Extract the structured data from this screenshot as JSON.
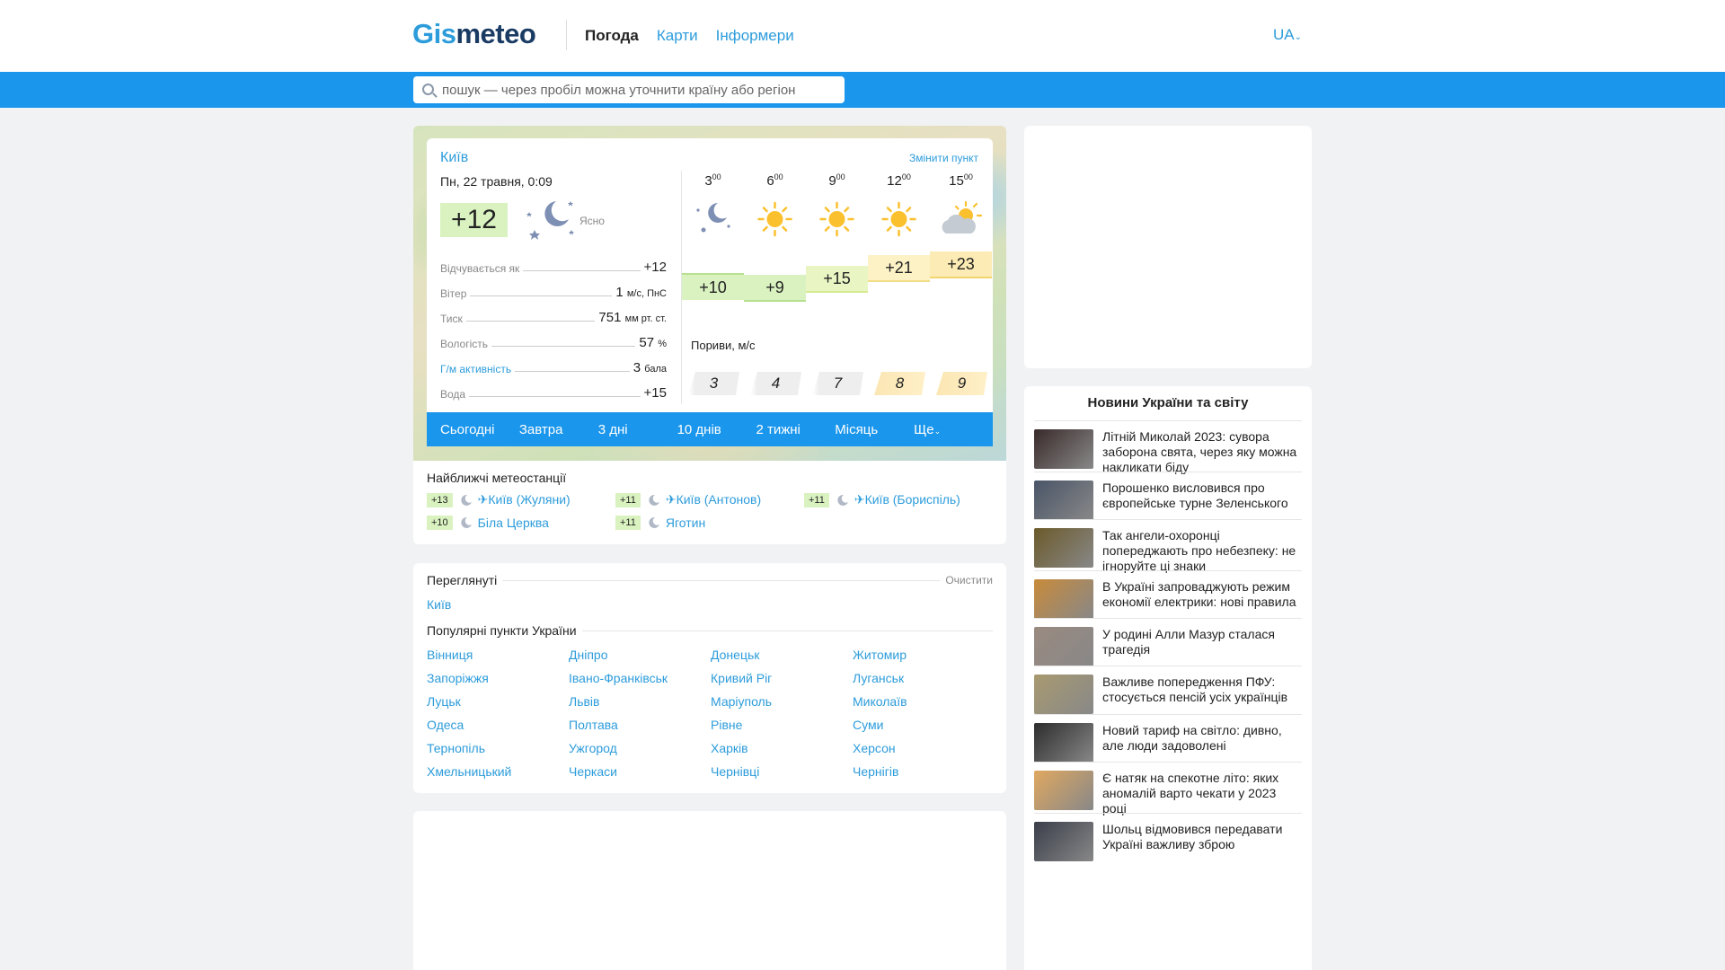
{
  "header": {
    "logo_part1": "Gis",
    "logo_part2": "meteo",
    "nav": [
      "Погода",
      "Карти",
      "Інформери"
    ],
    "lang": "UA"
  },
  "search": {
    "placeholder": "пошук — через пробіл можна уточнити країну або регіон"
  },
  "weather": {
    "city": "Київ",
    "change_label": "Змінити пункт",
    "date": "Пн, 22 травня, 0:09",
    "current_temp": "+12",
    "condition": "Ясно",
    "params": [
      {
        "label": "Відчувається як",
        "value": "+12",
        "unit": ""
      },
      {
        "label": "Вітер",
        "value": "1",
        "unit": "м/с, ПнС"
      },
      {
        "label": "Тиск",
        "value": "751",
        "unit": "мм рт. ст."
      },
      {
        "label": "Вологість",
        "value": "57",
        "unit": "%"
      },
      {
        "label": "Г/м активність",
        "value": "3",
        "unit": "бала"
      },
      {
        "label": "Вода",
        "value": "+15",
        "unit": ""
      }
    ],
    "hours": [
      {
        "hour": "3",
        "min": "00",
        "temp": "+10",
        "icon": "moon-stars-icon",
        "gust": "3"
      },
      {
        "hour": "6",
        "min": "00",
        "temp": "+9",
        "icon": "sun-icon",
        "gust": "4"
      },
      {
        "hour": "9",
        "min": "00",
        "temp": "+15",
        "icon": "sun-icon",
        "gust": "7"
      },
      {
        "hour": "12",
        "min": "00",
        "temp": "+21",
        "icon": "sun-icon",
        "gust": "8"
      },
      {
        "hour": "15",
        "min": "00",
        "temp": "+23",
        "icon": "partly-cloudy-icon",
        "gust": "9"
      }
    ],
    "gust_label": "Пориви, м/с",
    "tabs": [
      "Сьогодні",
      "Завтра",
      "3 дні",
      "10 днів",
      "2 тижні",
      "Місяць",
      "Ще"
    ]
  },
  "stations": {
    "title": "Найближчі метеостанції",
    "items": [
      {
        "temp": "+13",
        "name": "✈Київ (Жуляни)"
      },
      {
        "temp": "+11",
        "name": "✈Київ (Антонов)"
      },
      {
        "temp": "+11",
        "name": "✈Київ (Бориспіль)"
      },
      {
        "temp": "+10",
        "name": "Біла Церква"
      },
      {
        "temp": "+11",
        "name": "Яготин"
      }
    ]
  },
  "visited": {
    "title": "Переглянуті",
    "clear_label": "Очистити",
    "link": "Київ",
    "popular_title": "Популярні пункти України",
    "cities": [
      "Вінниця",
      "Дніпро",
      "Донецьк",
      "Житомир",
      "Запоріжжя",
      "Івано-Франківськ",
      "Кривий Ріг",
      "Луганськ",
      "Луцьк",
      "Львів",
      "Маріуполь",
      "Миколаїв",
      "Одеса",
      "Полтава",
      "Рівне",
      "Суми",
      "Тернопіль",
      "Ужгород",
      "Харків",
      "Херсон",
      "Хмельницький",
      "Черкаси",
      "Чернівці",
      "Чернігів"
    ]
  },
  "news": {
    "title": "Новини України та світу",
    "items": [
      {
        "text": "Літній Миколай 2023: сувора заборона свята, через яку можна накликати біду",
        "color": "#3a2a2a"
      },
      {
        "text": "Порошенко висловився про європейське турне Зеленського",
        "color": "#4a5568"
      },
      {
        "text": "Так ангели-охоронці попереджають про небезпеку: не ігноруйте ці знаки",
        "color": "#6b5a2a"
      },
      {
        "text": "В Україні запроваджують режим економії електрики: нові правила",
        "color": "#c88a3a"
      },
      {
        "text": "У родині Алли Мазур сталася трагедія",
        "color": "#9a8a80"
      },
      {
        "text": "Важливе попередження ПФУ: стосується пенсій усіх українців",
        "color": "#a89a70"
      },
      {
        "text": "Новий тариф на світло: дивно, але люди задоволені",
        "color": "#2d2d2d"
      },
      {
        "text": "Є натяк на спекотне літо: яких аномалій варто чекати у 2023 році",
        "color": "#e0a860"
      },
      {
        "text": "Шольц відмовився передавати Україні важливу зброю",
        "color": "#3a3e4a"
      }
    ]
  }
}
